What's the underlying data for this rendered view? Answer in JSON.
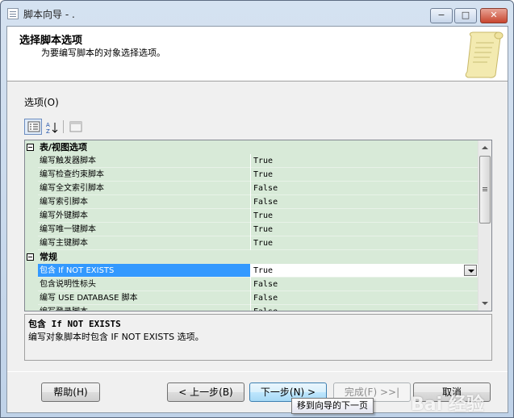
{
  "window": {
    "title": "脚本向导 - .",
    "min": "−",
    "max": "□",
    "close": "✕"
  },
  "header": {
    "title": "选择脚本选项",
    "subtitle": "为要编写脚本的对象选择选项。"
  },
  "options_label": "选项(O)",
  "grid": {
    "categories": [
      {
        "name": "表/视图选项",
        "rows": [
          {
            "name": "编写触发器脚本",
            "value": "True"
          },
          {
            "name": "编写检查约束脚本",
            "value": "True"
          },
          {
            "name": "编写全文索引脚本",
            "value": "False"
          },
          {
            "name": "编写索引脚本",
            "value": "False"
          },
          {
            "name": "编写外键脚本",
            "value": "True"
          },
          {
            "name": "编写唯一键脚本",
            "value": "True"
          },
          {
            "name": "编写主键脚本",
            "value": "True"
          }
        ]
      },
      {
        "name": "常规",
        "rows": [
          {
            "name": "包含 If NOT EXISTS",
            "value": "True"
          },
          {
            "name": "包含说明性标头",
            "value": "False"
          },
          {
            "name": "编写 USE DATABASE 脚本",
            "value": "False"
          },
          {
            "name": "编写登录脚本",
            "value": "False"
          }
        ]
      }
    ]
  },
  "description": {
    "title": "包含 If NOT EXISTS",
    "text": "编写对象脚本时包含 IF NOT EXISTS 选项。"
  },
  "buttons": {
    "help": "帮助(H)",
    "back": "< 上一步(B)",
    "next": "下一步(N) >",
    "finish": "完成(F) >>|",
    "cancel": "取消"
  },
  "tooltip": "移到向导的下一页",
  "watermark": "Bai 经验"
}
